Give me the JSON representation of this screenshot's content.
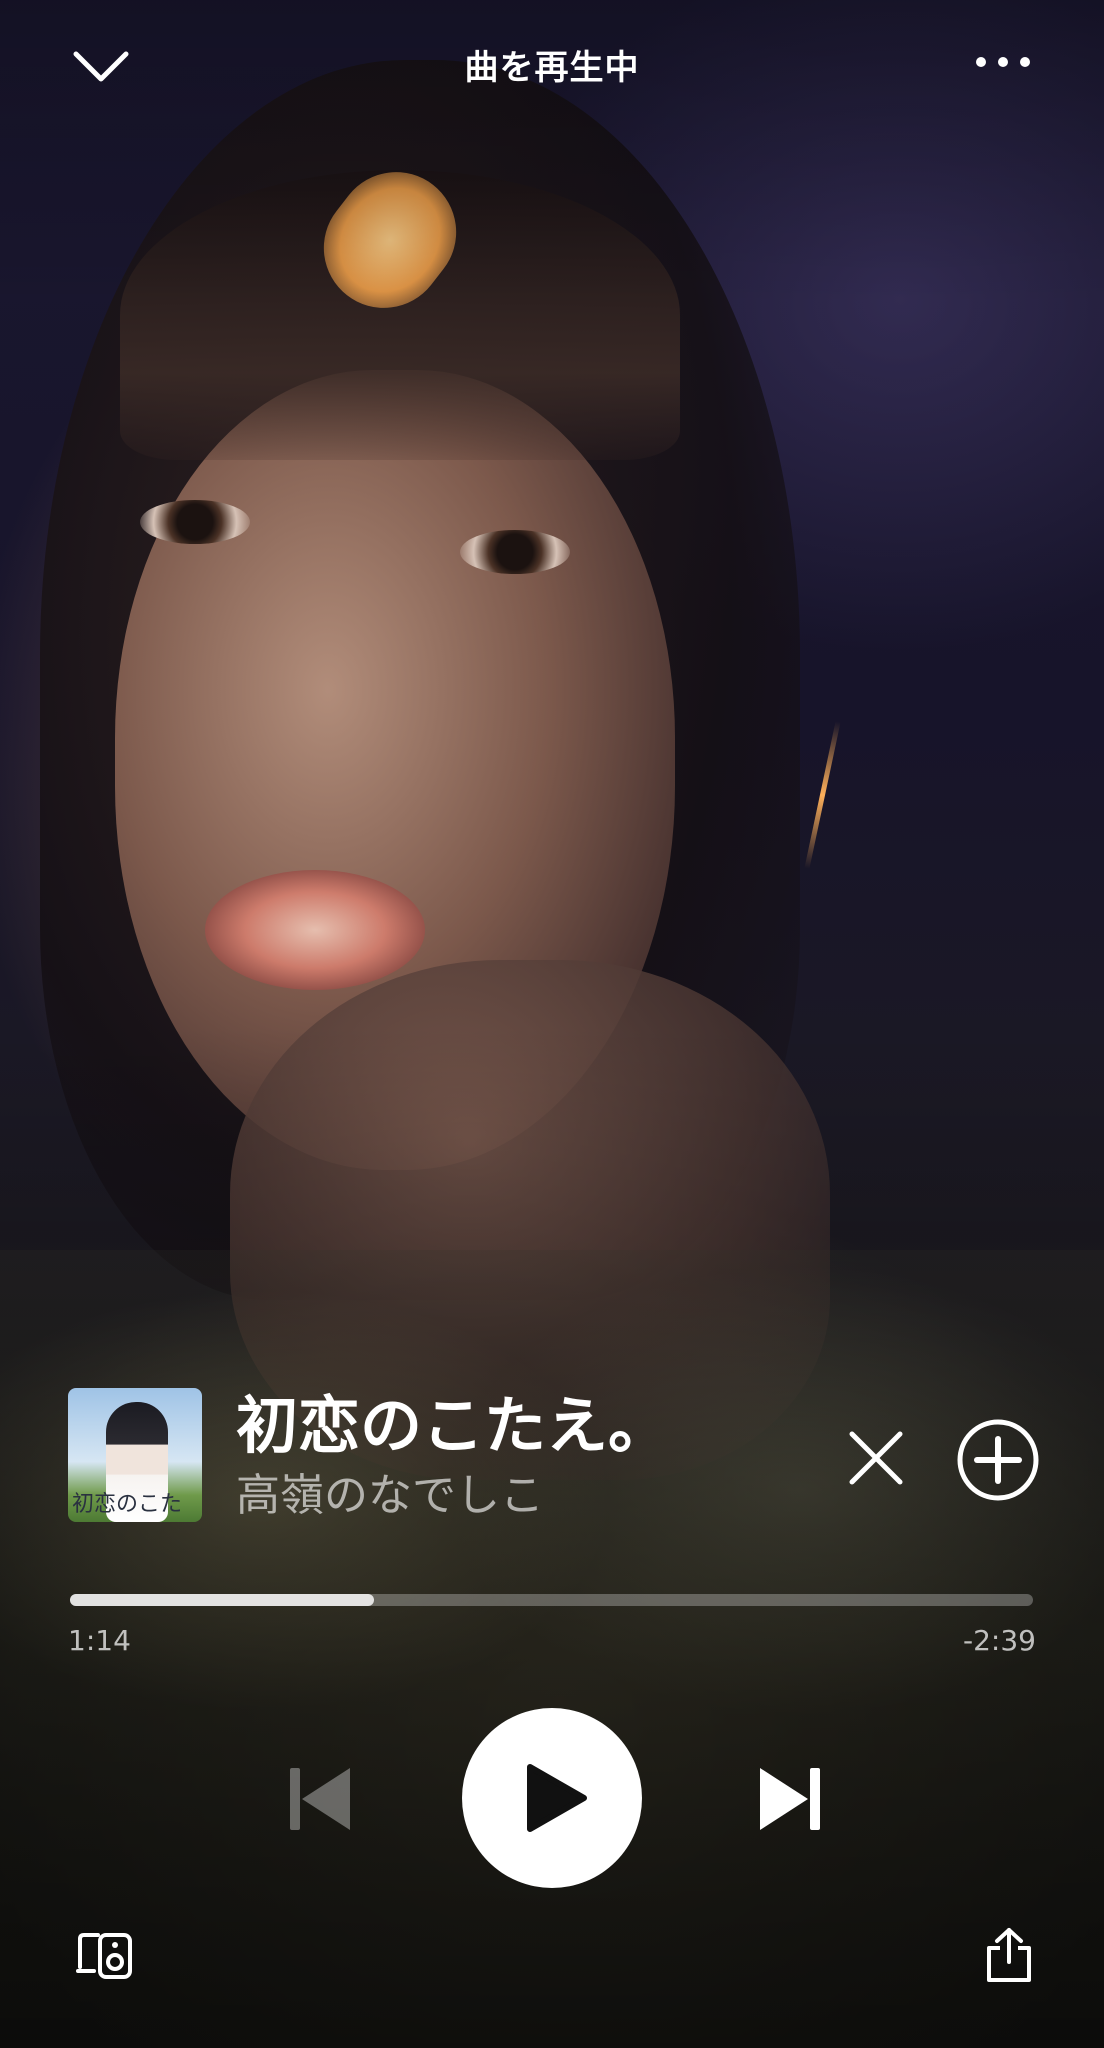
{
  "header": {
    "title": "曲を再生中",
    "collapse_icon": "chevron-down-icon",
    "more_icon": "more-horizontal-icon"
  },
  "track": {
    "title": "初恋のこたえ。",
    "artist": "高嶺のなでしこ",
    "cover_text": "初恋のこた"
  },
  "progress": {
    "elapsed": "1:14",
    "remaining": "-2:39",
    "fraction": 0.316
  },
  "controls": {
    "previous_icon": "skip-previous-icon",
    "play_icon": "play-icon",
    "next_icon": "skip-next-icon",
    "dislike_icon": "close-icon",
    "add_icon": "add-circle-icon",
    "devices_icon": "devices-icon",
    "share_icon": "share-icon"
  },
  "colors": {
    "accent": "#ffffff",
    "progress_track": "rgba(255,255,255,0.28)",
    "progress_fill": "rgba(255,255,255,0.82)",
    "disabled_icon": "rgba(255,255,255,0.35)"
  }
}
